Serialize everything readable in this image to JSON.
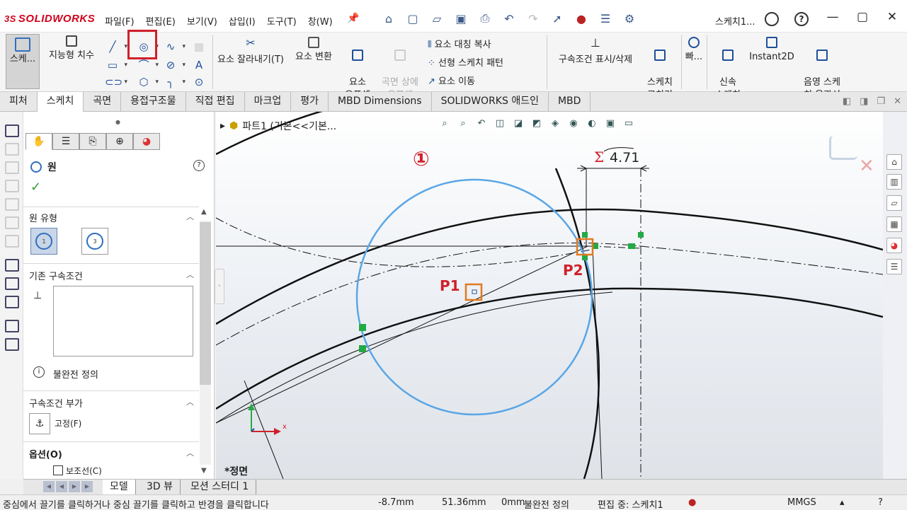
{
  "app": {
    "logo": "SOLIDWORKS",
    "doc_title": "스케치1..."
  },
  "menu": [
    "파일(F)",
    "편집(E)",
    "보기(V)",
    "삽입(I)",
    "도구(T)",
    "창(W)"
  ],
  "ribbon": {
    "sketch": "스케...",
    "smart_dim": "지능형 치수",
    "trim": "요소 잘라내기(T)",
    "convert": "요소 변환",
    "offset": "요소\n오프셋",
    "offset_surface": "곡면 상에\n오프셋",
    "mirror": "요소 대칭 복사",
    "linear_pattern": "선형 스케치 패턴",
    "move": "요소 이동",
    "relations": "구속조건 표시/삭제",
    "repair": "스케치\n고치기",
    "quick": "빠...",
    "rapid": "신속\n스케치",
    "instant2d": "Instant2D",
    "shaded": "음영 스케\n치 윤곽선"
  },
  "tabs": [
    "피처",
    "스케치",
    "곡면",
    "용접구조물",
    "직접 편집",
    "마크업",
    "평가",
    "MBD Dimensions",
    "SOLIDWORKS 애드인",
    "MBD"
  ],
  "active_tab": "스케치",
  "tree": {
    "label": "파트1  (기본<<기본..."
  },
  "pm": {
    "title": "원",
    "circle_type_header": "원 유형",
    "existing_relations_header": "기존 구속조건",
    "status": "불완전 정의",
    "add_relations_header": "구속조건 부가",
    "fix_label": "고정(F)",
    "options_header": "옵션(O)",
    "construction": "보조선(C)"
  },
  "canvas": {
    "dimension": "4.71",
    "sigma": "Σ",
    "annotation_marker": "①",
    "p1": "P1",
    "p2": "P2",
    "view": "*정면",
    "axis_x": "x"
  },
  "bottom_tabs": [
    "모델",
    "3D 뷰",
    "모션 스터디 1"
  ],
  "status": {
    "message": "중심에서 끌기를 클릭하거나 중심 끌기를 클릭하고 반경을 클릭합니다",
    "x": "-8.7mm",
    "y": "51.36mm",
    "z": "0mm",
    "definition": "불완전 정의",
    "editing": "편집 중: 스케치1",
    "units": "MMGS"
  },
  "colors": {
    "accent_red": "#d0202a",
    "circle_blue": "#5aa6e6",
    "marker_orange": "#e07a1f",
    "relation_green": "#22aa44"
  }
}
